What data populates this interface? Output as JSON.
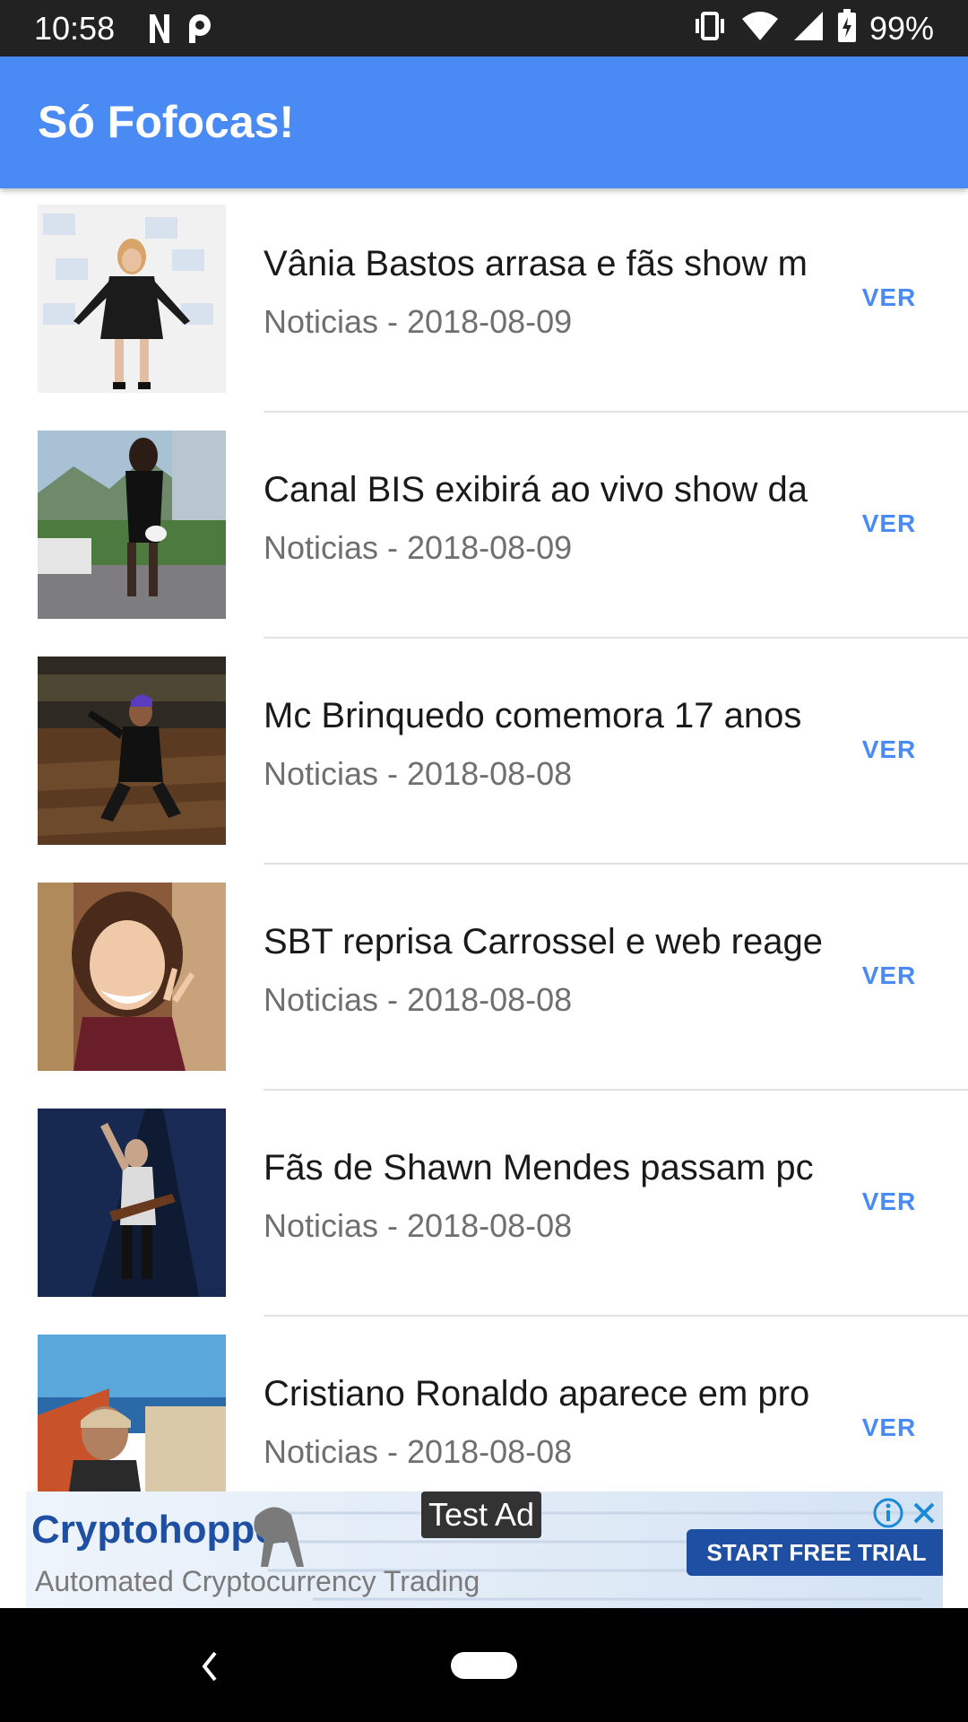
{
  "status_bar": {
    "time": "10:58",
    "left_icons": [
      "n-icon",
      "p-icon"
    ],
    "right_icons": [
      "vibrate-icon",
      "wifi-icon",
      "signal-icon",
      "battery-icon"
    ],
    "battery": "99%"
  },
  "app_bar": {
    "title": "Só Fofocas!",
    "color": "#4a8af4"
  },
  "news": [
    {
      "title": "Vânia Bastos arrasa e fãs show m",
      "subtitle": "Noticias - 2018-08-09",
      "button": "VER"
    },
    {
      "title": "Canal BIS exibirá ao vivo show da",
      "subtitle": "Noticias - 2018-08-09",
      "button": "VER"
    },
    {
      "title": "Mc Brinquedo comemora 17 anos",
      "subtitle": "Noticias - 2018-08-08",
      "button": "VER"
    },
    {
      "title": "SBT reprisa Carrossel e web reage",
      "subtitle": "Noticias - 2018-08-08",
      "button": "VER"
    },
    {
      "title": "Fãs de Shawn Mendes passam pc",
      "subtitle": "Noticias - 2018-08-08",
      "button": "VER"
    },
    {
      "title": "Cristiano Ronaldo aparece em pro",
      "subtitle": "Noticias - 2018-08-08",
      "button": "VER"
    }
  ],
  "ad": {
    "label": "Test Ad",
    "brand": "Cryptohopper",
    "tagline": "Automated Cryptocurrency Trading",
    "cta": "START FREE TRIAL"
  }
}
